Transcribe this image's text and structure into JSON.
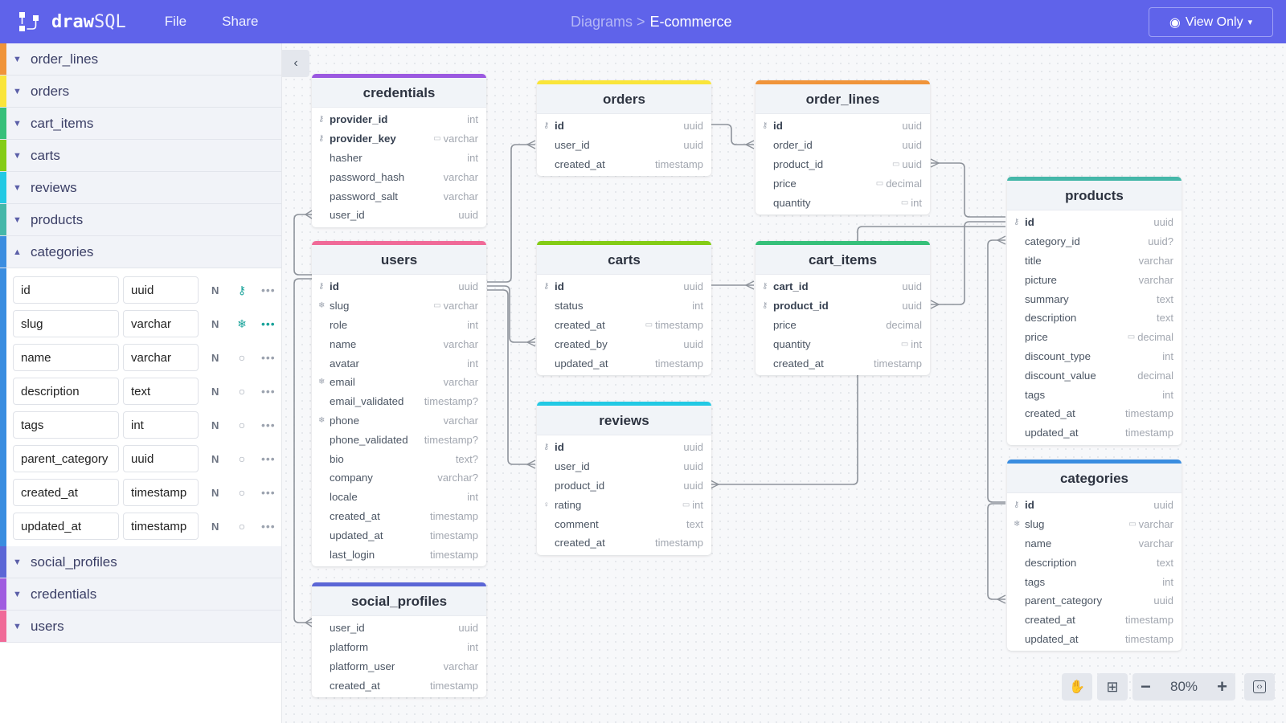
{
  "app": {
    "logo_text_bold": "draw",
    "logo_text_light": "SQL",
    "nav": [
      "File",
      "Share"
    ],
    "breadcrumb": {
      "parent": "Diagrams >",
      "current": "E-commerce"
    },
    "view_button": "View Only"
  },
  "sidebar": {
    "top_items": [
      {
        "label": "order_lines",
        "color": "#f0943a"
      },
      {
        "label": "orders",
        "color": "#fae53a"
      },
      {
        "label": "cart_items",
        "color": "#36c07a"
      },
      {
        "label": "carts",
        "color": "#84cc16"
      },
      {
        "label": "reviews",
        "color": "#22c9e4"
      },
      {
        "label": "products",
        "color": "#45b7a9"
      }
    ],
    "expanded": {
      "label": "categories",
      "color": "#3a8de0",
      "columns": [
        {
          "name": "id",
          "type": "uuid",
          "nullable": "N",
          "icon": "key"
        },
        {
          "name": "slug",
          "type": "varchar",
          "nullable": "N",
          "icon": "snowflake"
        },
        {
          "name": "name",
          "type": "varchar",
          "nullable": "N",
          "icon": "circle"
        },
        {
          "name": "description",
          "type": "text",
          "nullable": "N",
          "icon": "circle"
        },
        {
          "name": "tags",
          "type": "int",
          "nullable": "N",
          "icon": "circle"
        },
        {
          "name": "parent_category",
          "type": "uuid",
          "nullable": "N",
          "icon": "circle"
        },
        {
          "name": "created_at",
          "type": "timestamp",
          "nullable": "N",
          "icon": "circle"
        },
        {
          "name": "updated_at",
          "type": "timestamp",
          "nullable": "N",
          "icon": "circle"
        }
      ]
    },
    "bottom_items": [
      {
        "label": "social_profiles",
        "color": "#5b66d6"
      },
      {
        "label": "credentials",
        "color": "#a05ce0"
      },
      {
        "label": "users",
        "color": "#f06a98"
      }
    ]
  },
  "tables": [
    {
      "name": "credentials",
      "color": "#9b59e0",
      "rows": [
        {
          "n": "provider_id",
          "t": "int",
          "k": "key",
          "b": true
        },
        {
          "n": "provider_key",
          "t": "varchar",
          "k": "key",
          "b": true,
          "c": true
        },
        {
          "n": "hasher",
          "t": "int"
        },
        {
          "n": "password_hash",
          "t": "varchar"
        },
        {
          "n": "password_salt",
          "t": "varchar"
        },
        {
          "n": "user_id",
          "t": "uuid"
        }
      ]
    },
    {
      "name": "users",
      "color": "#f06a98",
      "rows": [
        {
          "n": "id",
          "t": "uuid",
          "k": "key",
          "b": true
        },
        {
          "n": "slug",
          "t": "varchar",
          "k": "snow",
          "c": true
        },
        {
          "n": "role",
          "t": "int"
        },
        {
          "n": "name",
          "t": "varchar"
        },
        {
          "n": "avatar",
          "t": "int"
        },
        {
          "n": "email",
          "t": "varchar",
          "k": "snow"
        },
        {
          "n": "email_validated",
          "t": "timestamp?"
        },
        {
          "n": "phone",
          "t": "varchar",
          "k": "snow"
        },
        {
          "n": "phone_validated",
          "t": "timestamp?"
        },
        {
          "n": "bio",
          "t": "text?"
        },
        {
          "n": "company",
          "t": "varchar?"
        },
        {
          "n": "locale",
          "t": "int"
        },
        {
          "n": "created_at",
          "t": "timestamp"
        },
        {
          "n": "updated_at",
          "t": "timestamp"
        },
        {
          "n": "last_login",
          "t": "timestamp"
        }
      ]
    },
    {
      "name": "social_profiles",
      "color": "#5b66d6",
      "rows": [
        {
          "n": "user_id",
          "t": "uuid"
        },
        {
          "n": "platform",
          "t": "int"
        },
        {
          "n": "platform_user",
          "t": "varchar"
        },
        {
          "n": "created_at",
          "t": "timestamp"
        }
      ]
    },
    {
      "name": "orders",
      "color": "#fae53a",
      "rows": [
        {
          "n": "id",
          "t": "uuid",
          "k": "key",
          "b": true
        },
        {
          "n": "user_id",
          "t": "uuid"
        },
        {
          "n": "created_at",
          "t": "timestamp"
        }
      ]
    },
    {
      "name": "carts",
      "color": "#84cc16",
      "rows": [
        {
          "n": "id",
          "t": "uuid",
          "k": "key",
          "b": true
        },
        {
          "n": "status",
          "t": "int"
        },
        {
          "n": "created_at",
          "t": "timestamp",
          "c": true
        },
        {
          "n": "created_by",
          "t": "uuid"
        },
        {
          "n": "updated_at",
          "t": "timestamp"
        }
      ]
    },
    {
      "name": "reviews",
      "color": "#22c9e4",
      "rows": [
        {
          "n": "id",
          "t": "uuid",
          "k": "key",
          "b": true
        },
        {
          "n": "user_id",
          "t": "uuid"
        },
        {
          "n": "product_id",
          "t": "uuid"
        },
        {
          "n": "rating",
          "t": "int",
          "k": "pin",
          "c": true
        },
        {
          "n": "comment",
          "t": "text"
        },
        {
          "n": "created_at",
          "t": "timestamp"
        }
      ]
    },
    {
      "name": "order_lines",
      "color": "#f0943a",
      "rows": [
        {
          "n": "id",
          "t": "uuid",
          "k": "key",
          "b": true
        },
        {
          "n": "order_id",
          "t": "uuid"
        },
        {
          "n": "product_id",
          "t": "uuid",
          "c": true
        },
        {
          "n": "price",
          "t": "decimal",
          "c": true
        },
        {
          "n": "quantity",
          "t": "int",
          "c": true
        }
      ]
    },
    {
      "name": "cart_items",
      "color": "#36c07a",
      "rows": [
        {
          "n": "cart_id",
          "t": "uuid",
          "k": "key",
          "b": true
        },
        {
          "n": "product_id",
          "t": "uuid",
          "k": "key",
          "b": true
        },
        {
          "n": "price",
          "t": "decimal"
        },
        {
          "n": "quantity",
          "t": "int",
          "c": true
        },
        {
          "n": "created_at",
          "t": "timestamp"
        }
      ]
    },
    {
      "name": "products",
      "color": "#45b7a9",
      "rows": [
        {
          "n": "id",
          "t": "uuid",
          "k": "key",
          "b": true
        },
        {
          "n": "category_id",
          "t": "uuid?"
        },
        {
          "n": "title",
          "t": "varchar"
        },
        {
          "n": "picture",
          "t": "varchar"
        },
        {
          "n": "summary",
          "t": "text"
        },
        {
          "n": "description",
          "t": "text"
        },
        {
          "n": "price",
          "t": "decimal",
          "c": true
        },
        {
          "n": "discount_type",
          "t": "int"
        },
        {
          "n": "discount_value",
          "t": "decimal"
        },
        {
          "n": "tags",
          "t": "int"
        },
        {
          "n": "created_at",
          "t": "timestamp"
        },
        {
          "n": "updated_at",
          "t": "timestamp"
        }
      ]
    },
    {
      "name": "categories",
      "color": "#3a8de0",
      "rows": [
        {
          "n": "id",
          "t": "uuid",
          "k": "key",
          "b": true
        },
        {
          "n": "slug",
          "t": "varchar",
          "k": "snow",
          "c": true
        },
        {
          "n": "name",
          "t": "varchar"
        },
        {
          "n": "description",
          "t": "text"
        },
        {
          "n": "tags",
          "t": "int"
        },
        {
          "n": "parent_category",
          "t": "uuid"
        },
        {
          "n": "created_at",
          "t": "timestamp"
        },
        {
          "n": "updated_at",
          "t": "timestamp"
        }
      ]
    }
  ],
  "zoom": {
    "level": "80%"
  }
}
